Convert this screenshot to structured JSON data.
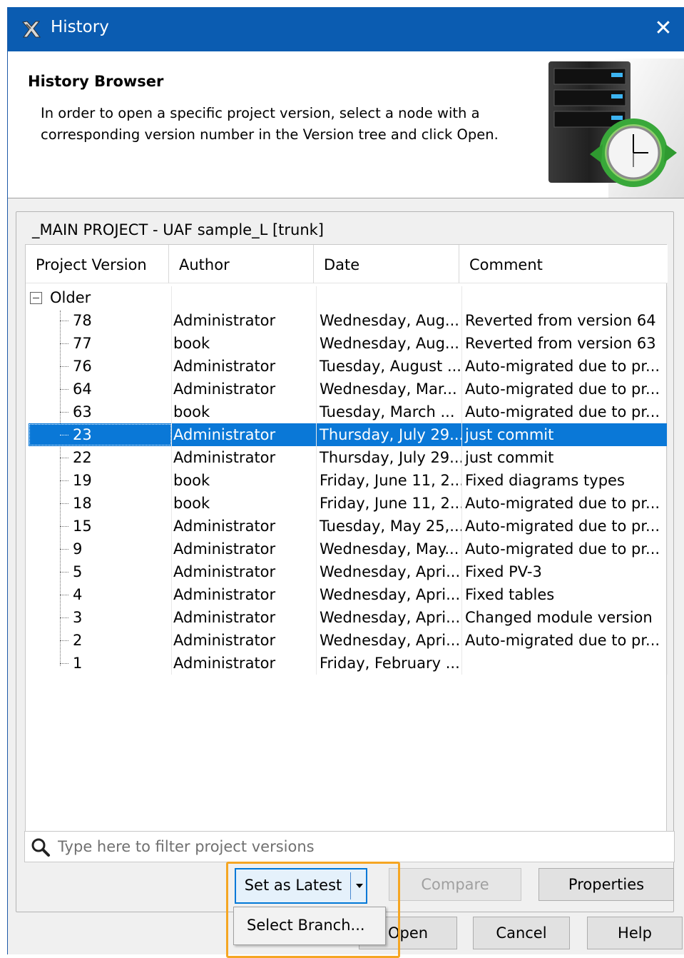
{
  "window": {
    "title": "History",
    "close_glyph": "✕"
  },
  "header": {
    "title": "History Browser",
    "description": "In order to open a specific project version, select a node with a corresponding version number in the Version tree and click Open."
  },
  "group": {
    "legend": "_MAIN PROJECT - UAF sample_L [trunk]"
  },
  "table": {
    "columns": [
      "Project Version",
      "Author",
      "Date",
      "Comment"
    ],
    "root": "Older",
    "rows": [
      {
        "version": "78",
        "author": "Administrator",
        "date": "Wednesday, Aug...",
        "comment": "Reverted from version 64"
      },
      {
        "version": "77",
        "author": "book",
        "date": "Wednesday, Aug...",
        "comment": "Reverted from version 63"
      },
      {
        "version": "76",
        "author": "Administrator",
        "date": "Tuesday, August ...",
        "comment": "Auto-migrated due to pr..."
      },
      {
        "version": "64",
        "author": "Administrator",
        "date": "Wednesday, Mar...",
        "comment": "Auto-migrated due to pr..."
      },
      {
        "version": "63",
        "author": "book",
        "date": "Tuesday, March ...",
        "comment": "Auto-migrated due to pr..."
      },
      {
        "version": "23",
        "author": "Administrator",
        "date": "Thursday, July 29...",
        "comment": "just commit"
      },
      {
        "version": "22",
        "author": "Administrator",
        "date": "Thursday, July 29...",
        "comment": "just commit"
      },
      {
        "version": "19",
        "author": "book",
        "date": "Friday, June 11, 2...",
        "comment": "Fixed diagrams types"
      },
      {
        "version": "18",
        "author": "book",
        "date": "Friday, June 11, 2...",
        "comment": "Auto-migrated due to pr..."
      },
      {
        "version": "15",
        "author": "Administrator",
        "date": "Tuesday, May 25,...",
        "comment": "Auto-migrated due to pr..."
      },
      {
        "version": "9",
        "author": "Administrator",
        "date": "Wednesday, May...",
        "comment": "Auto-migrated due to pr..."
      },
      {
        "version": "5",
        "author": "Administrator",
        "date": "Wednesday, Apri...",
        "comment": "Fixed PV-3"
      },
      {
        "version": "4",
        "author": "Administrator",
        "date": "Wednesday, Apri...",
        "comment": "Fixed tables"
      },
      {
        "version": "3",
        "author": "Administrator",
        "date": "Wednesday, Apri...",
        "comment": "Changed module version"
      },
      {
        "version": "2",
        "author": "Administrator",
        "date": "Wednesday, Apri...",
        "comment": "Auto-migrated due to pr..."
      },
      {
        "version": "1",
        "author": "Administrator",
        "date": "Friday, February ...",
        "comment": ""
      }
    ]
  },
  "filter": {
    "placeholder": "Type here to filter project versions"
  },
  "buttons": {
    "set_as_latest": "Set as Latest",
    "compare": "Compare",
    "properties": "Properties",
    "open": "Open",
    "cancel": "Cancel",
    "help": "Help"
  },
  "dropdown": {
    "items": [
      "Select Branch..."
    ]
  },
  "colors": {
    "title_bar": "#0b5cb1",
    "selection": "#0a78d7",
    "highlight": "#f5a623"
  },
  "icons": {
    "app": "cameo-logo-icon",
    "header": "server-clock-icon",
    "search": "search-icon"
  }
}
